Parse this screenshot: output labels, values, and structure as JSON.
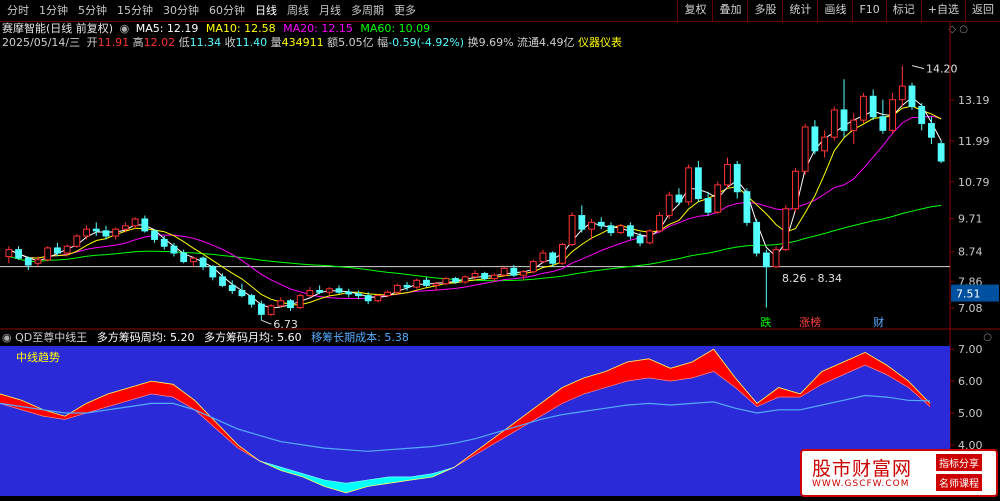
{
  "toolbar": {
    "periods": [
      "分时",
      "1分钟",
      "5分钟",
      "15分钟",
      "30分钟",
      "60分钟",
      "日线",
      "周线",
      "月线",
      "多周期",
      "更多"
    ],
    "active": "日线",
    "right_buttons": [
      "复权",
      "叠加",
      "多股",
      "统计",
      "画线",
      "F10",
      "标记",
      "+自选",
      "返回"
    ]
  },
  "stock": {
    "title": "赛摩智能(日线 前复权)",
    "ma5": "MA5: 12.19",
    "ma10": "MA10: 12.58",
    "ma20": "MA20: 12.15",
    "ma60": "MA60: 10.09",
    "date": "2025/05/14/三",
    "open_label": "开",
    "open": "11.91",
    "high_label": "高",
    "high": "12.02",
    "low_label": "低",
    "low": "11.34",
    "close_label": "收",
    "close": "11.40",
    "vol_label": "量",
    "vol": "434911",
    "amt_label": "额",
    "amt": "5.05亿",
    "chg_label": "幅",
    "chg": "-0.59(-4.92%)",
    "turn_label": "换",
    "turn": "9.69%",
    "float_label": "流通",
    "float": "4.49亿",
    "industry": "仪器仪表"
  },
  "indicator": {
    "name": "QD至尊中线王",
    "zhou": "多方筹码周均: 5.20",
    "yue": "多方筹码月均: 5.60",
    "chengben": "移筹长期成本: 5.38",
    "title": "中线趋势"
  },
  "price_axis": {
    "ticks": [
      "13.19",
      "11.99",
      "10.79",
      "9.71",
      "8.74",
      "7.86",
      "7.08"
    ],
    "current": "7.51"
  },
  "ind_axis": {
    "ticks": [
      "7.00",
      "6.00",
      "5.00",
      "4.00"
    ]
  },
  "annotations": {
    "high": "14.20",
    "low": "6.73",
    "range": "8.26 - 8.34",
    "events": [
      "跌",
      "涨榜",
      "财"
    ]
  },
  "colors": {
    "up": "#ff3232",
    "down": "#54ffff",
    "ma5": "#ffffff",
    "ma10": "#ffff00",
    "ma20": "#ff00ff",
    "ma60": "#00ff00",
    "ind_bg": "#2a2ad8",
    "bull": "#ff0000",
    "bear": "#00ffff",
    "cost": "#55aaff"
  },
  "watermark": {
    "title": "股市财富网",
    "url": "WWW.GSCFW.COM",
    "badge1": "指标分享",
    "badge2": "名师课程"
  },
  "chart_data": [
    {
      "type": "candlestick",
      "title": "赛摩智能(日线 前复权)",
      "y_ticks": [
        13.19,
        11.99,
        10.79,
        9.71,
        8.74,
        7.86,
        7.08
      ],
      "ylim": [
        6.5,
        14.6
      ],
      "series": [
        {
          "name": "OHLC",
          "values": [
            [
              8.6,
              8.9,
              8.4,
              8.8
            ],
            [
              8.8,
              8.9,
              8.5,
              8.55
            ],
            [
              8.55,
              8.6,
              8.2,
              8.35
            ],
            [
              8.4,
              8.6,
              8.3,
              8.5
            ],
            [
              8.5,
              8.9,
              8.45,
              8.85
            ],
            [
              8.85,
              9.0,
              8.6,
              8.7
            ],
            [
              8.7,
              8.95,
              8.6,
              8.9
            ],
            [
              8.9,
              9.25,
              8.85,
              9.2
            ],
            [
              9.2,
              9.5,
              9.1,
              9.4
            ],
            [
              9.4,
              9.6,
              9.2,
              9.35
            ],
            [
              9.35,
              9.5,
              9.1,
              9.2
            ],
            [
              9.2,
              9.45,
              9.1,
              9.4
            ],
            [
              9.4,
              9.6,
              9.3,
              9.5
            ],
            [
              9.5,
              9.75,
              9.4,
              9.7
            ],
            [
              9.7,
              9.8,
              9.3,
              9.35
            ],
            [
              9.35,
              9.4,
              9.0,
              9.1
            ],
            [
              9.1,
              9.2,
              8.8,
              8.9
            ],
            [
              8.9,
              9.0,
              8.6,
              8.7
            ],
            [
              8.7,
              8.8,
              8.4,
              8.45
            ],
            [
              8.45,
              8.6,
              8.3,
              8.55
            ],
            [
              8.55,
              8.6,
              8.2,
              8.3
            ],
            [
              8.3,
              8.35,
              7.9,
              8.0
            ],
            [
              8.0,
              8.1,
              7.7,
              7.75
            ],
            [
              7.75,
              7.9,
              7.5,
              7.6
            ],
            [
              7.6,
              7.8,
              7.4,
              7.45
            ],
            [
              7.45,
              7.5,
              7.1,
              7.2
            ],
            [
              7.2,
              7.3,
              6.73,
              6.9
            ],
            [
              6.9,
              7.2,
              6.85,
              7.15
            ],
            [
              7.15,
              7.4,
              7.1,
              7.3
            ],
            [
              7.3,
              7.35,
              7.0,
              7.1
            ],
            [
              7.1,
              7.5,
              7.05,
              7.45
            ],
            [
              7.45,
              7.7,
              7.4,
              7.6
            ],
            [
              7.6,
              7.75,
              7.5,
              7.55
            ],
            [
              7.55,
              7.7,
              7.45,
              7.65
            ],
            [
              7.65,
              7.75,
              7.5,
              7.55
            ],
            [
              7.55,
              7.65,
              7.4,
              7.5
            ],
            [
              7.5,
              7.6,
              7.35,
              7.45
            ],
            [
              7.45,
              7.55,
              7.2,
              7.3
            ],
            [
              7.3,
              7.5,
              7.25,
              7.45
            ],
            [
              7.45,
              7.6,
              7.4,
              7.55
            ],
            [
              7.55,
              7.8,
              7.5,
              7.75
            ],
            [
              7.75,
              7.85,
              7.6,
              7.7
            ],
            [
              7.7,
              7.95,
              7.65,
              7.9
            ],
            [
              7.9,
              8.0,
              7.7,
              7.75
            ],
            [
              7.75,
              7.85,
              7.6,
              7.8
            ],
            [
              7.8,
              8.0,
              7.75,
              7.95
            ],
            [
              7.95,
              8.0,
              7.8,
              7.85
            ],
            [
              7.85,
              8.05,
              7.8,
              8.0
            ],
            [
              8.0,
              8.2,
              7.9,
              8.1
            ],
            [
              8.1,
              8.15,
              7.9,
              7.95
            ],
            [
              7.95,
              8.1,
              7.85,
              8.05
            ],
            [
              8.05,
              8.3,
              8.0,
              8.25
            ],
            [
              8.25,
              8.35,
              8.0,
              8.05
            ],
            [
              8.05,
              8.2,
              7.9,
              8.15
            ],
            [
              8.15,
              8.5,
              8.1,
              8.45
            ],
            [
              8.45,
              8.8,
              8.4,
              8.7
            ],
            [
              8.7,
              8.75,
              8.3,
              8.4
            ],
            [
              8.4,
              9.0,
              8.35,
              8.95
            ],
            [
              8.95,
              9.9,
              8.9,
              9.8
            ],
            [
              9.8,
              10.1,
              9.3,
              9.4
            ],
            [
              9.4,
              9.7,
              9.1,
              9.6
            ],
            [
              9.6,
              9.75,
              9.4,
              9.5
            ],
            [
              9.5,
              9.6,
              9.2,
              9.3
            ],
            [
              9.3,
              9.55,
              9.25,
              9.5
            ],
            [
              9.5,
              9.6,
              9.1,
              9.2
            ],
            [
              9.2,
              9.3,
              8.9,
              9.0
            ],
            [
              9.0,
              9.4,
              8.95,
              9.35
            ],
            [
              9.35,
              9.9,
              9.3,
              9.8
            ],
            [
              9.8,
              10.5,
              9.7,
              10.4
            ],
            [
              10.4,
              10.6,
              10.1,
              10.2
            ],
            [
              10.2,
              11.3,
              10.1,
              11.2
            ],
            [
              11.2,
              11.4,
              10.2,
              10.3
            ],
            [
              10.3,
              10.5,
              9.8,
              9.9
            ],
            [
              9.9,
              10.8,
              9.85,
              10.7
            ],
            [
              10.7,
              11.5,
              10.6,
              11.3
            ],
            [
              11.3,
              11.4,
              10.3,
              10.5
            ],
            [
              10.5,
              10.6,
              9.5,
              9.6
            ],
            [
              9.6,
              9.7,
              8.6,
              8.7
            ],
            [
              8.7,
              8.8,
              7.1,
              8.3
            ],
            [
              8.3,
              8.9,
              8.26,
              8.8
            ],
            [
              8.8,
              10.1,
              8.75,
              10.0
            ],
            [
              10.0,
              11.2,
              9.9,
              11.1
            ],
            [
              11.1,
              12.5,
              11.0,
              12.4
            ],
            [
              12.4,
              12.6,
              11.6,
              11.7
            ],
            [
              11.7,
              12.3,
              11.5,
              12.1
            ],
            [
              12.1,
              13.0,
              12.0,
              12.9
            ],
            [
              12.9,
              13.8,
              12.1,
              12.3
            ],
            [
              12.3,
              12.8,
              11.9,
              12.6
            ],
            [
              12.6,
              13.4,
              12.5,
              13.3
            ],
            [
              13.3,
              13.5,
              12.6,
              12.7
            ],
            [
              12.7,
              13.2,
              12.2,
              12.3
            ],
            [
              12.3,
              13.4,
              12.2,
              13.2
            ],
            [
              13.2,
              14.2,
              13.0,
              13.6
            ],
            [
              13.6,
              13.7,
              12.9,
              13.0
            ],
            [
              13.0,
              13.1,
              12.3,
              12.5
            ],
            [
              12.5,
              12.7,
              11.9,
              12.1
            ],
            [
              11.91,
              12.02,
              11.34,
              11.4
            ]
          ]
        }
      ]
    },
    {
      "type": "area",
      "title": "中线趋势",
      "y_ticks": [
        7.0,
        6.0,
        5.0,
        4.0
      ],
      "ylim": [
        2.4,
        7.1
      ],
      "series": [
        {
          "name": "多方筹码周均",
          "values": [
            5.6,
            5.4,
            5.1,
            4.9,
            5.3,
            5.6,
            5.8,
            6.0,
            5.9,
            5.4,
            4.7,
            4.0,
            3.5,
            3.2,
            3.0,
            2.7,
            2.5,
            2.7,
            2.8,
            2.9,
            3.0,
            3.3,
            3.8,
            4.3,
            4.8,
            5.3,
            5.8,
            6.1,
            6.3,
            6.6,
            6.7,
            6.4,
            6.6,
            7.0,
            6.1,
            5.3,
            5.8,
            5.6,
            6.3,
            6.6,
            6.9,
            6.5,
            6.0,
            5.3
          ]
        },
        {
          "name": "多方筹码月均",
          "values": [
            5.3,
            5.1,
            4.9,
            4.8,
            5.0,
            5.2,
            5.4,
            5.6,
            5.5,
            5.1,
            4.5,
            3.9,
            3.5,
            3.3,
            3.1,
            2.9,
            2.8,
            2.9,
            3.0,
            3.0,
            3.1,
            3.3,
            3.7,
            4.1,
            4.5,
            4.9,
            5.3,
            5.6,
            5.8,
            6.0,
            6.1,
            6.0,
            6.1,
            6.3,
            5.8,
            5.2,
            5.5,
            5.5,
            5.9,
            6.2,
            6.5,
            6.2,
            5.8,
            5.2
          ]
        },
        {
          "name": "移筹长期成本",
          "values": [
            5.3,
            5.2,
            5.1,
            5.0,
            5.0,
            5.1,
            5.2,
            5.3,
            5.3,
            5.1,
            4.8,
            4.5,
            4.3,
            4.1,
            4.0,
            3.9,
            3.85,
            3.8,
            3.85,
            3.9,
            3.95,
            4.05,
            4.2,
            4.4,
            4.6,
            4.8,
            4.95,
            5.05,
            5.15,
            5.25,
            5.3,
            5.25,
            5.3,
            5.35,
            5.15,
            5.0,
            5.1,
            5.1,
            5.25,
            5.4,
            5.55,
            5.5,
            5.4,
            5.38
          ]
        }
      ]
    }
  ]
}
